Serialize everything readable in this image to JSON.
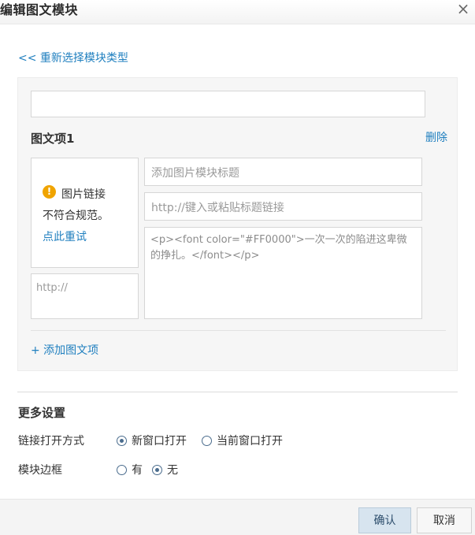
{
  "dialog": {
    "title": "编辑图文模块",
    "close_symbol": "×",
    "reselect_link": "<< 重新选择模块类型"
  },
  "item": {
    "label": "图文项1",
    "delete_label": "删除",
    "image_error": {
      "line1": "图片链接",
      "line2": "不符合规范。",
      "retry": "点此重试",
      "icon": "warning-icon"
    },
    "image_url_placeholder": "http://",
    "title_placeholder": "添加图片模块标题",
    "link_placeholder": "http://键入或粘贴标题链接",
    "content": "<p><font color=\"#FF0000\">一次一次的陷进这卑微的挣扎。</font></p>"
  },
  "add_item_label": "+ 添加图文项",
  "more_settings": {
    "title": "更多设置",
    "link_open": {
      "label": "链接打开方式",
      "options": [
        "新窗口打开",
        "当前窗口打开"
      ],
      "selected": "新窗口打开"
    },
    "border": {
      "label": "模块边框",
      "options": [
        "有",
        "无"
      ],
      "selected": "无"
    }
  },
  "footer": {
    "confirm_label": "确认",
    "cancel_label": "取消"
  },
  "colors": {
    "link": "#1f7fbf",
    "warning": "#f0a400",
    "confirm_bg": "#d7e4ef"
  }
}
